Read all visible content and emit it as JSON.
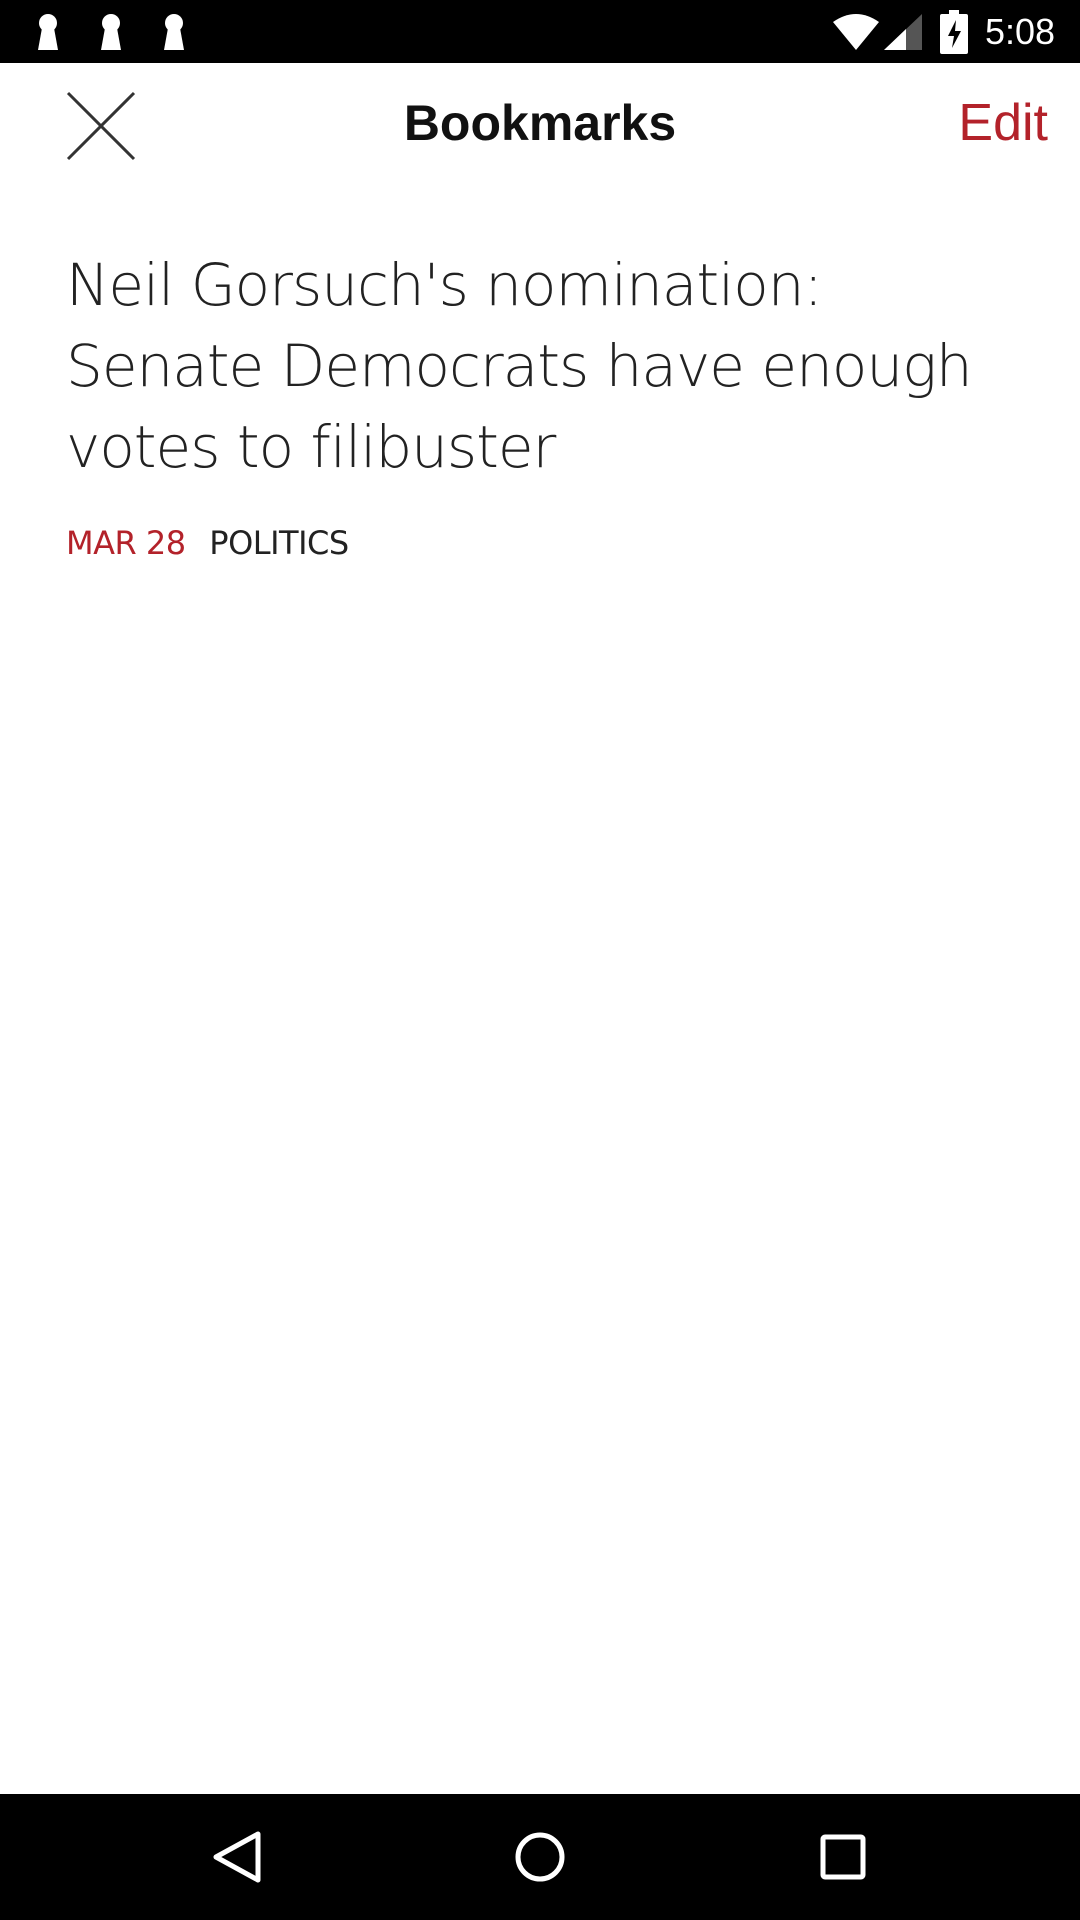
{
  "status_bar": {
    "time": "5:08",
    "notification_icons": [
      "keyhole-icon",
      "keyhole-icon",
      "keyhole-icon"
    ],
    "wifi_icon": "wifi-icon",
    "signal_icon": "cell-signal-icon",
    "battery_icon": "battery-charging-icon"
  },
  "header": {
    "title": "Bookmarks",
    "edit_label": "Edit",
    "close_icon": "close-icon"
  },
  "bookmarks": [
    {
      "title": "Neil Gorsuch's nomination: Senate Democrats have enough votes to filibuster",
      "date": "MAR 28",
      "section": "POLITICS"
    }
  ],
  "nav_bar": {
    "back_icon": "back-triangle-icon",
    "home_icon": "home-circle-icon",
    "recents_icon": "recents-square-icon"
  },
  "colors": {
    "accent": "#b3222a",
    "text": "#222222",
    "bars": "#000000",
    "background": "#ffffff"
  }
}
